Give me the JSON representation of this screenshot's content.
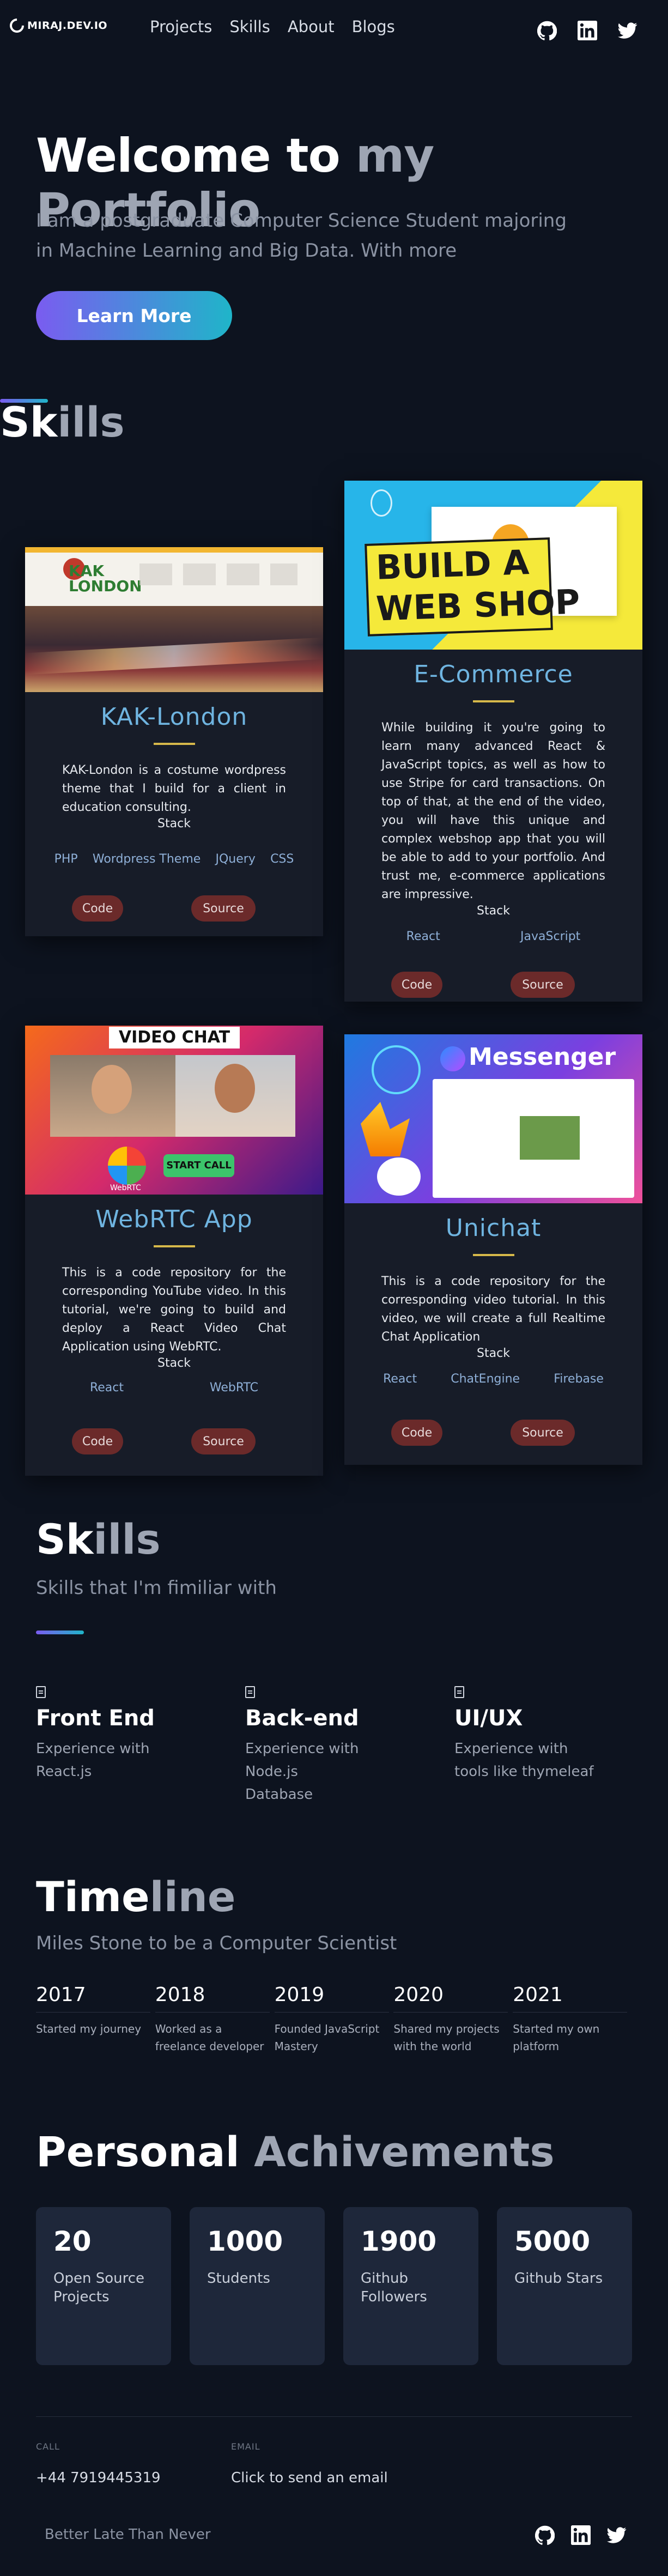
{
  "nav": {
    "logo": "MIRAJ.DEV.IO",
    "links": [
      "Projects",
      "Skills",
      "About",
      "Blogs"
    ],
    "icons": [
      "github-icon",
      "linkedin-icon",
      "twitter-icon"
    ]
  },
  "hero": {
    "title_part1": "Welcome to",
    "title_part2": "my Portfolio",
    "subtitle": "I am a postgraduate Computer Science Student majoring in Machine Learning and Big Data. With more",
    "button": "Learn More"
  },
  "projects_heading": {
    "first_letters": "Sk",
    "rest": "ills"
  },
  "projects": [
    {
      "title": "KAK-London",
      "image_text": "KAK LONDON",
      "description": "KAK-London is a costume wordpress theme that I build for a client in education consulting.",
      "stack_label": "Stack",
      "stack": [
        "PHP",
        "Wordpress Theme",
        "JQuery",
        "CSS"
      ],
      "code_label": "Code",
      "source_label": "Source"
    },
    {
      "title": "E-Commerce",
      "image_text_1": "BUILD A",
      "image_text_2": "WEB SHOP",
      "description": "While building it you're going to learn many advanced React & JavaScript topics, as well as how to use Stripe for card transactions. On top of that, at the end of the video, you will have this unique and complex webshop app that you will be able to add to your portfolio. And trust me, e-commerce applications are impressive.",
      "stack_label": "Stack",
      "stack": [
        "React",
        "JavaScript"
      ],
      "code_label": "Code",
      "source_label": "Source"
    },
    {
      "title": "WebRTC App",
      "image_text": "VIDEO CHAT",
      "image_button": "START CALL",
      "image_logo": "WebRTC",
      "description": "This is a code repository for the corresponding YouTube video. In this tutorial, we're going to build and deploy a React Video Chat Application using WebRTC.",
      "stack_label": "Stack",
      "stack": [
        "React",
        "WebRTC"
      ],
      "code_label": "Code",
      "source_label": "Source"
    },
    {
      "title": "Unichat",
      "image_text": "Messenger",
      "description": "This is a code repository for the corresponding video tutorial. In this video, we will create a full Realtime Chat Application",
      "stack_label": "Stack",
      "stack": [
        "React",
        "ChatEngine",
        "Firebase"
      ],
      "code_label": "Code",
      "source_label": "Source"
    }
  ],
  "skills": {
    "title_a": "Sk",
    "title_b": "ills",
    "subtitle": "Skills that I'm fimiliar with",
    "items": [
      {
        "title": "Front End",
        "desc_1": "Experience with",
        "desc_2": "React.js",
        "desc_3": ""
      },
      {
        "title": "Back-end",
        "desc_1": "Experience with",
        "desc_2": "Node.js",
        "desc_3": "Database"
      },
      {
        "title": "UI/UX",
        "desc_1": "Experience with",
        "desc_2": "tools like thymeleaf",
        "desc_3": ""
      }
    ]
  },
  "timeline": {
    "title_a": "Time",
    "title_b": "line",
    "subtitle": "Miles Stone to be a Computer Scientist",
    "items": [
      {
        "year": "2017",
        "desc": "Started my journey"
      },
      {
        "year": "2018",
        "desc": "Worked as a freelance developer"
      },
      {
        "year": "2019",
        "desc": "Founded JavaScript Mastery"
      },
      {
        "year": "2020",
        "desc": "Shared my projects with the world"
      },
      {
        "year": "2021",
        "desc": "Started my own platform"
      }
    ]
  },
  "achievements": {
    "title_a": "Personal",
    "title_b": "Achivements",
    "items": [
      {
        "num": "20",
        "label": "Open Source Projects"
      },
      {
        "num": "1000",
        "label": "Students"
      },
      {
        "num": "1900",
        "label": "Github Followers"
      },
      {
        "num": "5000",
        "label": "Github Stars"
      }
    ]
  },
  "footer": {
    "call_label": "CALL",
    "call_value": "+44 7919445319",
    "email_label": "EMAIL",
    "email_value": "Click to send an email",
    "tagline": "Better Late Than Never"
  },
  "colors": {
    "accent_purple": "#7a5cf0",
    "accent_teal": "#1fb5c9",
    "card_title": "#6fb4e0",
    "button": "#6b2a2a"
  }
}
